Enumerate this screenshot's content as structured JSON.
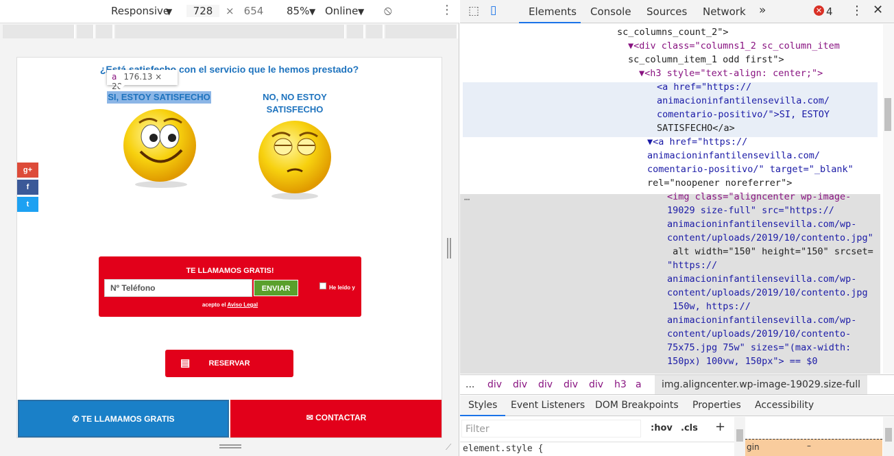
{
  "device_toolbar": {
    "mode": "Responsive",
    "width": "728",
    "times": "×",
    "height": "654",
    "zoom": "85%",
    "network": "Online"
  },
  "page": {
    "question": "¿Está satisfecho con el servicio que le hemos prestado?",
    "tooltip": {
      "tag": "a",
      "size": "176.13 × 20"
    },
    "yes_label": "SI, ESTOY SATISFECHO",
    "no_label_1": "NO, NO ESTOY",
    "no_label_2": "SATISFECHO",
    "social": [
      "g+",
      "f",
      "t"
    ],
    "form": {
      "title": "TE LLAMAMOS GRATIS!",
      "phone_placeholder": "Nº Teléfono",
      "send": "ENVIAR",
      "checkbox_label": "He leído y",
      "legal_prefix": "acepto el",
      "legal_link": "Aviso Legal"
    },
    "reserve": "RESERVAR",
    "call_button": "TE LLAMAMOS GRATIS",
    "contact_button": "CONTACTAR"
  },
  "devtools": {
    "tabs": [
      "Elements",
      "Console",
      "Sources",
      "Network"
    ],
    "error_count": "4",
    "code_lines": [
      {
        "t": "sc_columns_count_2\">"
      },
      {
        "t": "▼<div class=\"columns1_2 sc_column_item"
      },
      {
        "t": "sc_column_item_1 odd first\">"
      },
      {
        "t": "▼<h3 style=\"text-align: center;\">"
      },
      {
        "t": "<a href=\"https://"
      },
      {
        "t": "animacioninfantilensevilla.com/"
      },
      {
        "t": "comentario-positivo/\">SI, ESTOY"
      },
      {
        "t": "SATISFECHO</a>"
      },
      {
        "t": "▼<a href=\"https://"
      },
      {
        "t": "animacioninfantilensevilla.com/"
      },
      {
        "t": "comentario-positivo/\" target=\"_blank\""
      },
      {
        "t": "rel=\"noopener noreferrer\">"
      },
      {
        "t": "<img class=\"aligncenter wp-image-"
      },
      {
        "t": "19029 size-full\" src=\"https://"
      },
      {
        "t": "animacioninfantilensevilla.com/wp-"
      },
      {
        "t": "content/uploads/2019/10/contento.jpg\""
      },
      {
        "t": " alt width=\"150\" height=\"150\" srcset="
      },
      {
        "t": "\"https://"
      },
      {
        "t": "animacioninfantilensevilla.com/wp-"
      },
      {
        "t": "content/uploads/2019/10/contento.jpg"
      },
      {
        "t": " 150w, https://"
      },
      {
        "t": "animacioninfantilensevilla.com/wp-"
      },
      {
        "t": "content/uploads/2019/10/contento-"
      },
      {
        "t": "75x75.jpg 75w\" sizes=\"(max-width:"
      },
      {
        "t": "150px) 100vw, 150px\"> == $0"
      }
    ],
    "breadcrumb": [
      "...",
      "div",
      "div",
      "div",
      "div",
      "div",
      "h3",
      "a",
      "img.aligncenter.wp-image-19029.size-full"
    ],
    "style_tabs": [
      "Styles",
      "Event Listeners",
      "DOM Breakpoints",
      "Properties",
      "Accessibility"
    ],
    "filter_placeholder": "Filter",
    "hov": ":hov",
    "cls": ".cls",
    "plus": "+",
    "element_style": "element.style {",
    "margin_label": "gin",
    "margin_value": "–"
  }
}
